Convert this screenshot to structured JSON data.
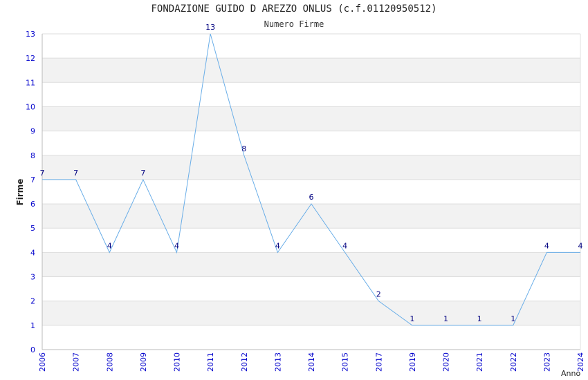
{
  "chart_data": {
    "type": "line",
    "title": "FONDAZIONE GUIDO D AREZZO ONLUS (c.f.01120950512)",
    "subtitle": "Numero Firme",
    "xlabel": "Anno",
    "ylabel": "Firme",
    "ylim": [
      0,
      13
    ],
    "yticks": [
      "0",
      "1",
      "2",
      "3",
      "4",
      "5",
      "6",
      "7",
      "8",
      "9",
      "10",
      "11",
      "12",
      "13"
    ],
    "categories": [
      "2006",
      "2007",
      "2008",
      "2009",
      "2010",
      "2011",
      "2012",
      "2013",
      "2014",
      "2015",
      "2017",
      "2019",
      "2020",
      "2021",
      "2022",
      "2023",
      "2024"
    ],
    "series": [
      {
        "values": [
          7,
          7,
          4,
          7,
          4,
          13,
          8,
          4,
          6,
          4,
          2,
          1,
          1,
          1,
          1,
          4,
          4
        ]
      }
    ],
    "grid": true
  },
  "colors": {
    "line": "#6aaee8",
    "tick_label": "#0000cc",
    "data_label": "#000080",
    "band": "#f2f2f2",
    "grid": "#dddddd"
  }
}
